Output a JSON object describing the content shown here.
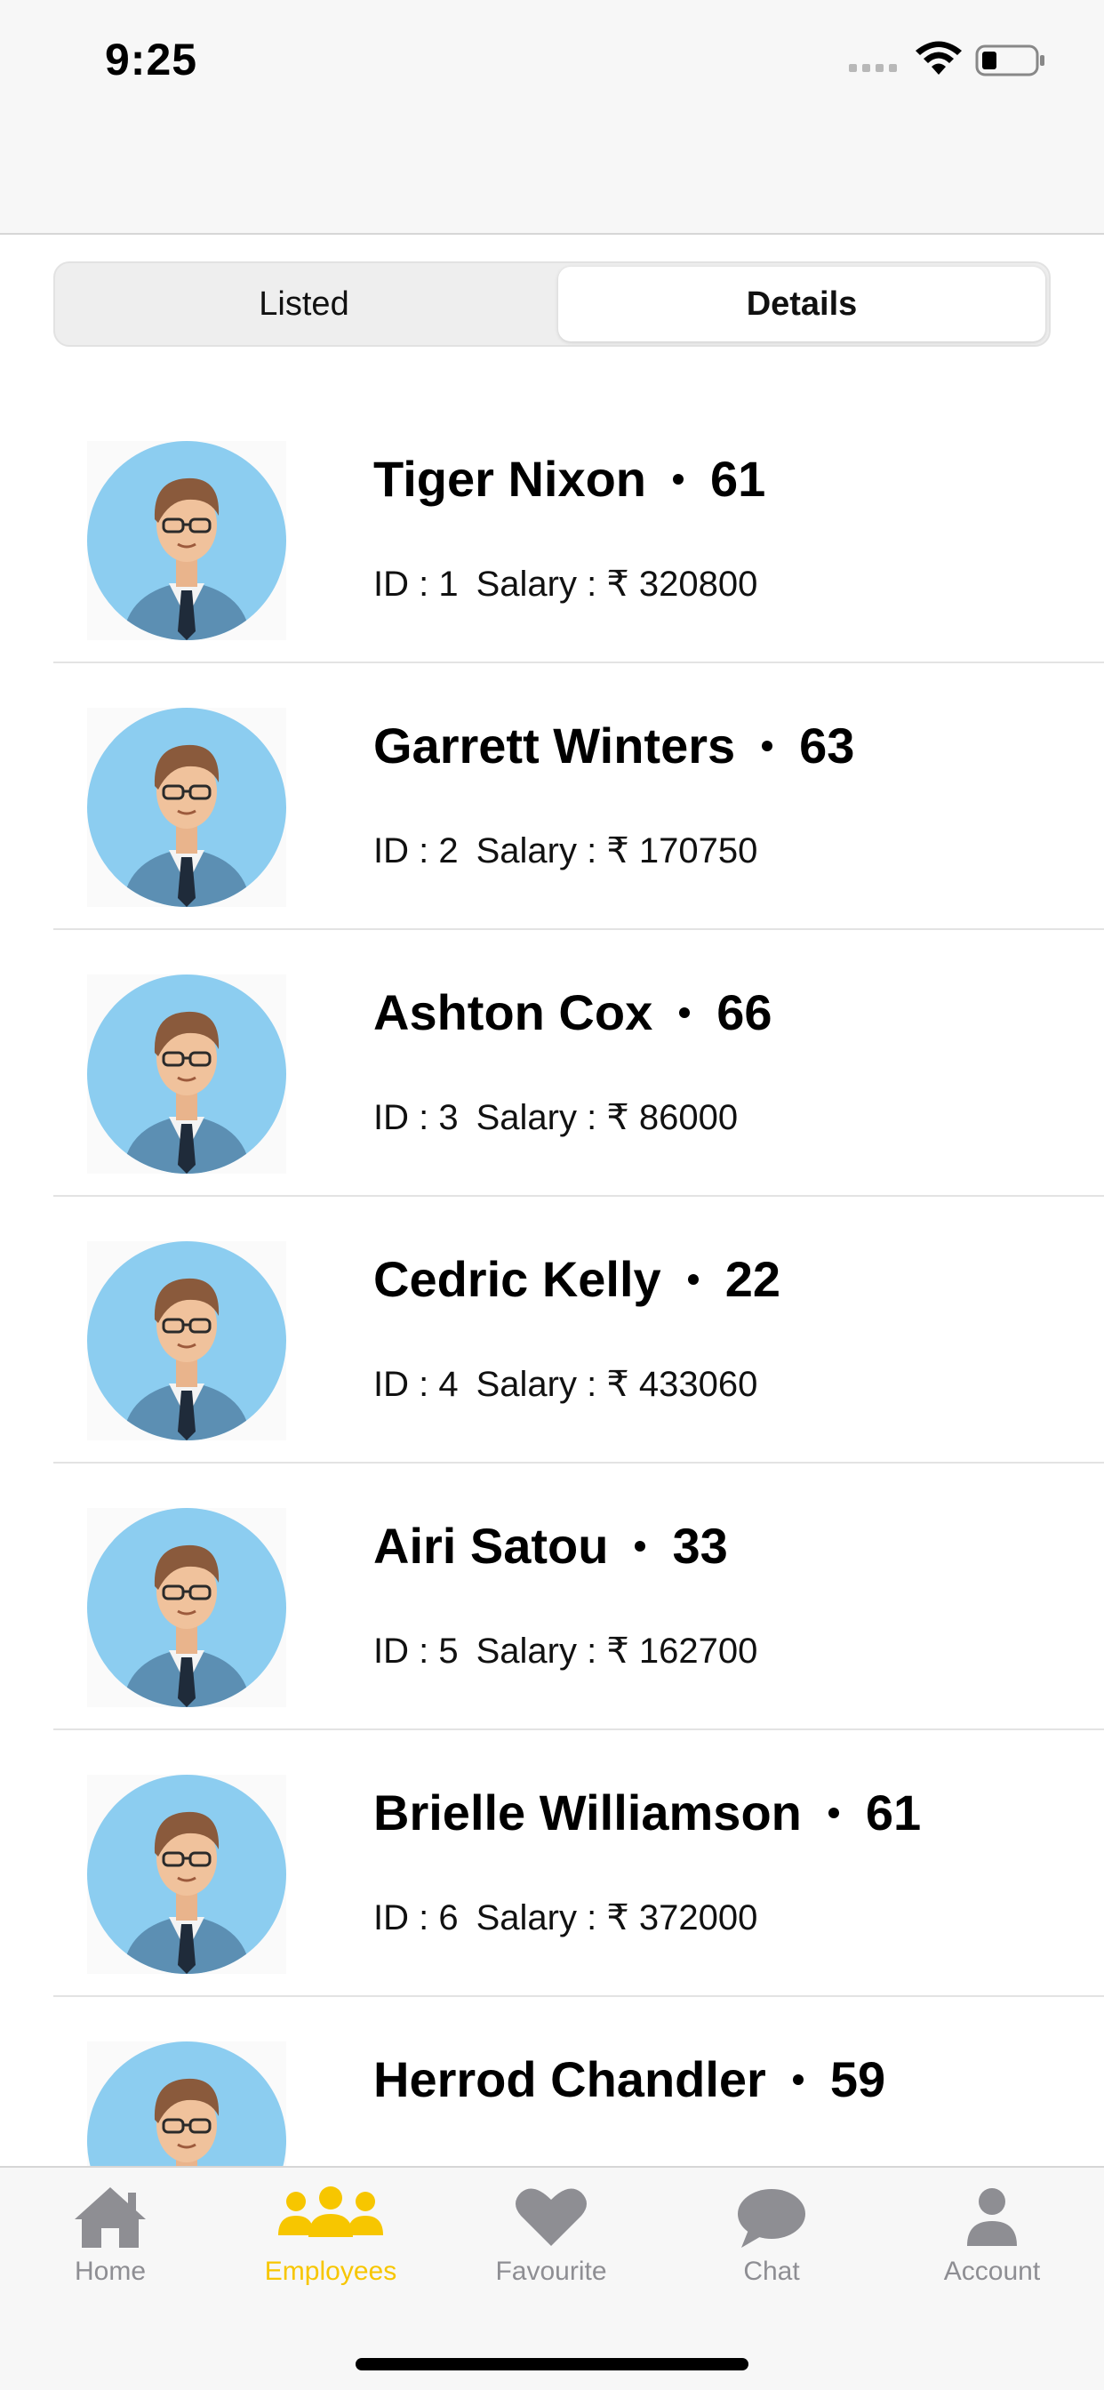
{
  "status_bar": {
    "time": "9:25"
  },
  "segments": [
    {
      "label": "Listed",
      "selected": false
    },
    {
      "label": "Details",
      "selected": true
    }
  ],
  "employees": [
    {
      "name": "Tiger Nixon",
      "age": "61",
      "id_label": "ID : 1",
      "salary_label": "Salary : ₹ 320800"
    },
    {
      "name": "Garrett Winters",
      "age": "63",
      "id_label": "ID : 2",
      "salary_label": "Salary : ₹ 170750"
    },
    {
      "name": "Ashton Cox",
      "age": "66",
      "id_label": "ID : 3",
      "salary_label": "Salary : ₹ 86000"
    },
    {
      "name": "Cedric Kelly",
      "age": "22",
      "id_label": "ID : 4",
      "salary_label": "Salary : ₹ 433060"
    },
    {
      "name": "Airi Satou",
      "age": "33",
      "id_label": "ID : 5",
      "salary_label": "Salary : ₹ 162700"
    },
    {
      "name": "Brielle Williamson",
      "age": "61",
      "id_label": "ID : 6",
      "salary_label": "Salary : ₹ 372000"
    },
    {
      "name": "Herrod Chandler",
      "age": "59",
      "id_label": "",
      "salary_label": ""
    }
  ],
  "tabbar": {
    "items": [
      {
        "label": "Home",
        "icon": "home-icon",
        "active": false
      },
      {
        "label": "Employees",
        "icon": "people-icon",
        "active": true
      },
      {
        "label": "Favourite",
        "icon": "heart-icon",
        "active": false
      },
      {
        "label": "Chat",
        "icon": "chat-bubble-icon",
        "active": false
      },
      {
        "label": "Account",
        "icon": "person-icon",
        "active": false
      }
    ]
  },
  "colors": {
    "accent": "#f7c600",
    "inactive": "#8e8e93",
    "avatar_bg": "#8ccdf0"
  }
}
